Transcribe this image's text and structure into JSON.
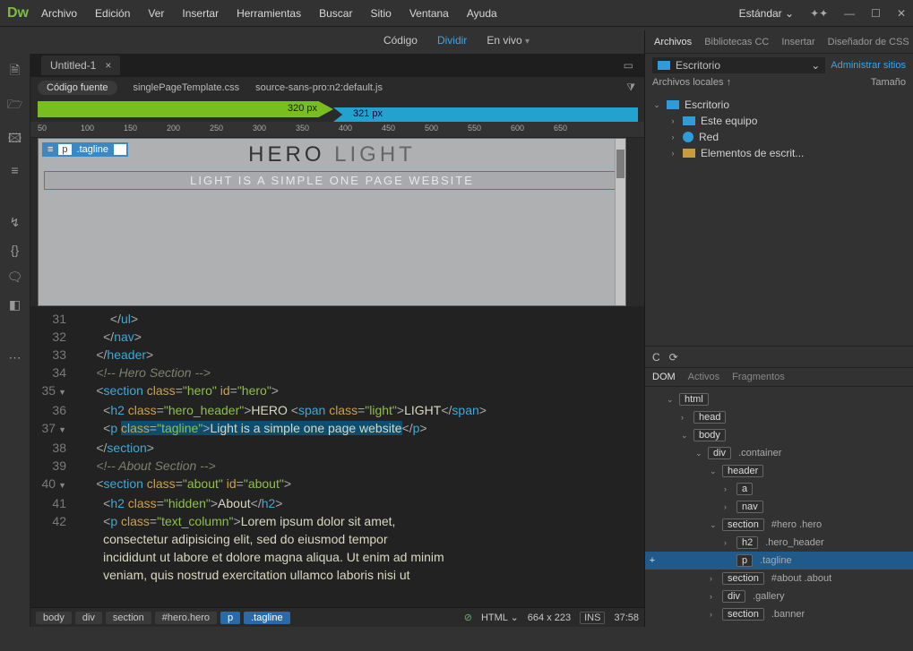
{
  "app": {
    "logo": "Dw"
  },
  "menu": [
    "Archivo",
    "Edición",
    "Ver",
    "Insertar",
    "Herramientas",
    "Buscar",
    "Sitio",
    "Ventana",
    "Ayuda"
  ],
  "workspace": "Estándar",
  "view_tabs": {
    "code": "Código",
    "split": "Dividir",
    "live": "En vivo"
  },
  "doc_tab": "Untitled-1",
  "source_row": {
    "btn": "Código fuente",
    "files": [
      "singlePageTemplate.css",
      "source-sans-pro:n2:default.js"
    ]
  },
  "media": {
    "green": "320  px",
    "blue": "321  px"
  },
  "ruler": [
    "50",
    "100",
    "150",
    "200",
    "250",
    "300",
    "350",
    "400",
    "450",
    "500",
    "550",
    "600",
    "650"
  ],
  "preview": {
    "crumb_tag": "p",
    "crumb_cls": ".tagline",
    "plus": "+",
    "hero_dark": "HERO",
    "hero_light": "LIGHT",
    "tagline": "LIGHT IS A SIMPLE ONE PAGE WEBSITE"
  },
  "code_lines": [
    {
      "n": "31",
      "html": "          <span class='c-brk'>&lt;/</span><span class='c-tag'>ul</span><span class='c-brk'>&gt;</span>"
    },
    {
      "n": "32",
      "html": "        <span class='c-brk'>&lt;/</span><span class='c-tag'>nav</span><span class='c-brk'>&gt;</span>"
    },
    {
      "n": "33",
      "html": "      <span class='c-brk'>&lt;/</span><span class='c-tag'>header</span><span class='c-brk'>&gt;</span>"
    },
    {
      "n": "34",
      "html": "      <span class='c-cmt'>&lt;!-- Hero Section --&gt;</span>"
    },
    {
      "n": "35",
      "arr": "▼",
      "html": "      <span class='c-brk'>&lt;</span><span class='c-tag'>section</span> <span class='c-attr'>class</span><span class='c-brk'>=</span><span class='c-str'>\"hero\"</span> <span class='c-attr'>id</span><span class='c-brk'>=</span><span class='c-str'>\"hero\"</span><span class='c-brk'>&gt;</span>"
    },
    {
      "n": "36",
      "html": "        <span class='c-brk'>&lt;</span><span class='c-tag'>h2</span> <span class='c-attr'>class</span><span class='c-brk'>=</span><span class='c-str'>\"hero_header\"</span><span class='c-brk'>&gt;</span><span class='c-txt'>HERO </span><span class='c-brk'>&lt;</span><span class='c-tag'>span</span> <span class='c-attr'>class</span><span class='c-brk'>=</span><span class='c-str'>\"light\"</span><span class='c-brk'>&gt;</span><span class='c-txt'>LIGHT</span><span class='c-brk'>&lt;/</span><span class='c-tag'>span</span><span class='c-brk'>&gt;</span>"
    },
    {
      "n": "37",
      "arr": "▼",
      "html": "        <span class='c-brk'>&lt;</span><span class='c-tag'>p</span> <span class='c-sel'><span class='c-attr'>class</span><span class='c-brk'>=</span><span class='c-str'>\"tagline\"</span><span class='c-brk'>&gt;</span><span class='c-txt'>Light is a simple one page website</span></span><span class='c-brk'>&lt;/</span><span class='c-tag'>p</span><span class='c-brk'>&gt;</span>"
    },
    {
      "n": "38",
      "html": "      <span class='c-brk'>&lt;/</span><span class='c-tag'>section</span><span class='c-brk'>&gt;</span>"
    },
    {
      "n": "39",
      "html": "      <span class='c-cmt'>&lt;!-- About Section --&gt;</span>"
    },
    {
      "n": "40",
      "arr": "▼",
      "html": "      <span class='c-brk'>&lt;</span><span class='c-tag'>section</span> <span class='c-attr'>class</span><span class='c-brk'>=</span><span class='c-str'>\"about\"</span> <span class='c-attr'>id</span><span class='c-brk'>=</span><span class='c-str'>\"about\"</span><span class='c-brk'>&gt;</span>"
    },
    {
      "n": "41",
      "html": "        <span class='c-brk'>&lt;</span><span class='c-tag'>h2</span> <span class='c-attr'>class</span><span class='c-brk'>=</span><span class='c-str'>\"hidden\"</span><span class='c-brk'>&gt;</span><span class='c-txt'>About</span><span class='c-brk'>&lt;/</span><span class='c-tag'>h2</span><span class='c-brk'>&gt;</span>"
    },
    {
      "n": "42",
      "html": "        <span class='c-brk'>&lt;</span><span class='c-tag'>p</span> <span class='c-attr'>class</span><span class='c-brk'>=</span><span class='c-str'>\"text_column\"</span><span class='c-brk'>&gt;</span><span class='c-txt'>Lorem ipsum dolor sit amet,</span>"
    },
    {
      "n": "",
      "html": "<span class='c-txt'>        consectetur adipisicing elit, sed do eiusmod tempor</span>"
    },
    {
      "n": "",
      "html": "<span class='c-txt'>        incididunt ut labore et dolore magna aliqua. Ut enim ad minim</span>"
    },
    {
      "n": "",
      "html": "<span class='c-txt'>        veniam, quis nostrud exercitation ullamco laboris nisi ut</span>"
    }
  ],
  "status": {
    "crumbs": [
      {
        "t": "body",
        "sel": false
      },
      {
        "t": "div",
        "sel": false
      },
      {
        "t": "section",
        "sel": false
      },
      {
        "t": "#hero.hero",
        "sel": false
      },
      {
        "t": "p",
        "sel": true
      },
      {
        "t": ".tagline",
        "sel": true
      }
    ],
    "lang": "HTML",
    "size": "664 x 223",
    "ins": "INS",
    "time": "37:58"
  },
  "files_panel": {
    "tabs": [
      "Archivos",
      "Bibliotecas CC",
      "Insertar",
      "Diseñador de CSS"
    ],
    "drive": "Escritorio",
    "manage": "Administrar sitios",
    "cols": {
      "c1": "Archivos locales ↑",
      "c2": "Tamaño"
    },
    "rows": [
      {
        "ind": 0,
        "exp": "⌄",
        "ico": "mon",
        "label": "Escritorio"
      },
      {
        "ind": 1,
        "exp": "›",
        "ico": "mon",
        "label": "Este equipo"
      },
      {
        "ind": 1,
        "exp": "›",
        "ico": "net",
        "label": "Red"
      },
      {
        "ind": 1,
        "exp": "›",
        "ico": "fold",
        "label": "Elementos de escrit..."
      }
    ]
  },
  "dom_panel": {
    "tabs": [
      "DOM",
      "Activos",
      "Fragmentos"
    ],
    "rows": [
      {
        "ind": 0,
        "exp": "⌄",
        "tag": "html",
        "extra": ""
      },
      {
        "ind": 1,
        "exp": "›",
        "tag": "head",
        "extra": ""
      },
      {
        "ind": 1,
        "exp": "⌄",
        "tag": "body",
        "extra": ""
      },
      {
        "ind": 2,
        "exp": "⌄",
        "tag": "div",
        "extra": ".container"
      },
      {
        "ind": 3,
        "exp": "⌄",
        "tag": "header",
        "extra": ""
      },
      {
        "ind": 4,
        "exp": "›",
        "tag": "a",
        "extra": ""
      },
      {
        "ind": 4,
        "exp": "›",
        "tag": "nav",
        "extra": ""
      },
      {
        "ind": 3,
        "exp": "⌄",
        "tag": "section",
        "extra": "#hero .hero"
      },
      {
        "ind": 4,
        "exp": "›",
        "tag": "h2",
        "extra": ".hero_header"
      },
      {
        "ind": 4,
        "exp": "",
        "tag": "p",
        "extra": ".tagline",
        "sel": true,
        "plus": true
      },
      {
        "ind": 3,
        "exp": "›",
        "tag": "section",
        "extra": "#about .about"
      },
      {
        "ind": 3,
        "exp": "›",
        "tag": "div",
        "extra": ".gallery"
      },
      {
        "ind": 3,
        "exp": "›",
        "tag": "section",
        "extra": ".banner"
      }
    ]
  }
}
